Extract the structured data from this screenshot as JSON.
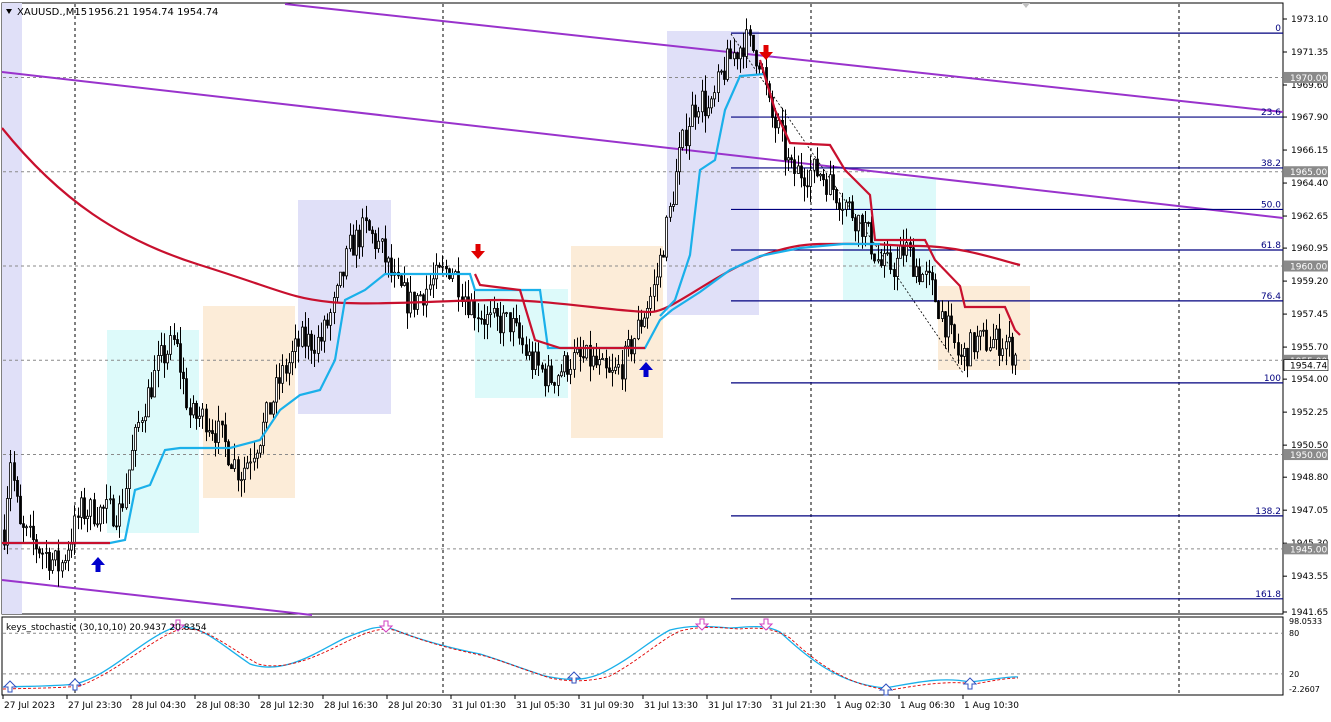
{
  "header": {
    "symbol_label": "XAUUSD.,M15",
    "ohlc_text": "1956.21 1954.74 1954.74",
    "menu_icon": "triangle-down-icon"
  },
  "price_axis": {
    "ticks": [
      "1973.10",
      "1971.35",
      "1969.60",
      "1967.90",
      "1966.15",
      "1964.40",
      "1962.65",
      "1960.95",
      "1959.20",
      "1957.45",
      "1955.70",
      "1954.00",
      "1952.25",
      "1950.50",
      "1948.80",
      "1947.05",
      "1945.30",
      "1943.55",
      "1941.65"
    ],
    "level_labels": [
      {
        "text": "1970.00",
        "price": 1970.0
      },
      {
        "text": "1965.00",
        "price": 1965.0
      },
      {
        "text": "1960.00",
        "price": 1960.0
      },
      {
        "text": "1955.00",
        "price": 1955.0
      },
      {
        "text": "1950.00",
        "price": 1950.0
      },
      {
        "text": "1945.00",
        "price": 1945.0
      }
    ],
    "current_price": "1954.74"
  },
  "fibonacci": {
    "levels": [
      {
        "label": "0",
        "price": 1972.35
      },
      {
        "label": "23.6",
        "price": 1967.9
      },
      {
        "label": "38.2",
        "price": 1965.2
      },
      {
        "label": "50.0",
        "price": 1963.0
      },
      {
        "label": "61.8",
        "price": 1960.85
      },
      {
        "label": "76.4",
        "price": 1958.15
      },
      {
        "label": "100",
        "price": 1953.8
      },
      {
        "label": "138.2",
        "price": 1946.75
      },
      {
        "label": "161.8",
        "price": 1942.35
      }
    ],
    "color": "#00007f"
  },
  "time_axis": {
    "labels": [
      "27 Jul 2023",
      "27 Jul 23:30",
      "28 Jul 04:30",
      "28 Jul 08:30",
      "28 Jul 12:30",
      "28 Jul 16:30",
      "28 Jul 20:30",
      "31 Jul 01:30",
      "31 Jul 05:30",
      "31 Jul 09:30",
      "31 Jul 13:30",
      "31 Jul 17:30",
      "31 Jul 21:30",
      "1 Aug 02:30",
      "1 Aug 06:30",
      "1 Aug 10:30"
    ]
  },
  "indicator": {
    "title": "keys_stochastic (30,10,10) 20.9437 20.8354",
    "axis_top": "98.0533",
    "level_high": "80",
    "level_low": "20",
    "axis_bottom": "-2.2607"
  },
  "colors": {
    "bull_arrow": "#0000cc",
    "bear_arrow": "#e00000",
    "ma_red": "#c8102e",
    "ma_blue": "#1ab0ea",
    "trendline": "#9933cc",
    "zone_blue": "#e0e0f8",
    "zone_cyan": "#ddfafa",
    "zone_orange": "#fcecd8",
    "candle": "#000000"
  },
  "signals": [
    {
      "type": "buy",
      "icon": "up-arrow-icon"
    },
    {
      "type": "sell",
      "icon": "down-arrow-icon"
    },
    {
      "type": "buy",
      "icon": "up-arrow-icon"
    },
    {
      "type": "sell",
      "icon": "down-arrow-icon"
    }
  ]
}
